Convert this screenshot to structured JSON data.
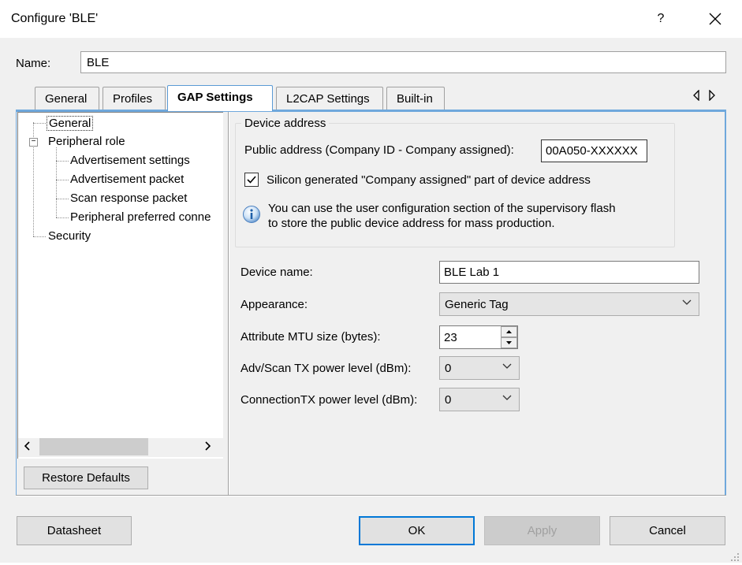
{
  "window": {
    "title": "Configure 'BLE'",
    "help_glyph": "?",
    "close_glyph": "✕"
  },
  "name_row": {
    "label": "Name:",
    "value": "BLE"
  },
  "tabs": [
    {
      "label": "General"
    },
    {
      "label": "Profiles"
    },
    {
      "label": "GAP Settings"
    },
    {
      "label": "L2CAP Settings"
    },
    {
      "label": "Built-in"
    }
  ],
  "tree": {
    "items": [
      {
        "label": "General"
      },
      {
        "label": "Peripheral role"
      },
      {
        "label": "Advertisement settings"
      },
      {
        "label": "Advertisement packet"
      },
      {
        "label": "Scan response packet"
      },
      {
        "label": "Peripheral preferred conne"
      },
      {
        "label": "Security"
      }
    ],
    "expander_glyph": "−"
  },
  "restore_defaults_label": "Restore Defaults",
  "device_address": {
    "legend": "Device address",
    "public_address_label": "Public address (Company ID - Company assigned):",
    "public_address_value": "00A050-XXXXXX",
    "checkbox_label": "Silicon generated \"Company assigned\" part of device address",
    "checkbox_checked": true,
    "info_line1": "You can use the user configuration section of the supervisory flash",
    "info_line2": "to store the public device address for mass production."
  },
  "fields": {
    "device_name_label": "Device name:",
    "device_name_value": "BLE Lab 1",
    "appearance_label": "Appearance:",
    "appearance_value": "Generic Tag",
    "mtu_label": "Attribute MTU size (bytes):",
    "mtu_value": "23",
    "adv_power_label": "Adv/Scan TX power level (dBm):",
    "adv_power_value": "0",
    "conn_power_label": "ConnectionTX power level (dBm):",
    "conn_power_value": "0"
  },
  "footer": {
    "datasheet_label": "Datasheet",
    "ok_label": "OK",
    "apply_label": "Apply",
    "cancel_label": "Cancel"
  },
  "icons": {
    "close": "close-icon",
    "help": "help-icon",
    "info": "info-icon",
    "check": "checkmark-icon",
    "chevron": "chevron-down-icon"
  },
  "colors": {
    "accent": "#0078d7",
    "tab_underline": "#6fa8dc",
    "dialog_bg": "#f0f0f0"
  }
}
